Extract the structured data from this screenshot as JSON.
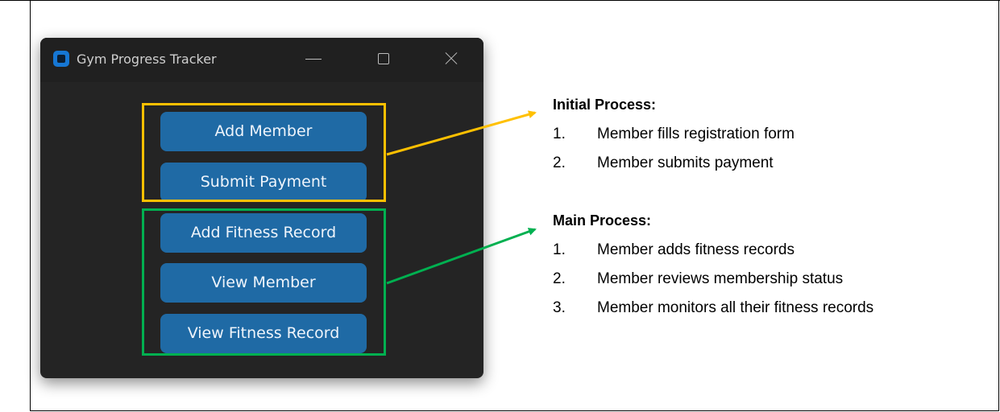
{
  "window": {
    "title": "Gym Progress Tracker"
  },
  "buttons": {
    "add_member": "Add Member",
    "submit_payment": "Submit Payment",
    "add_fitness_record": "Add Fitness Record",
    "view_member": "View Member",
    "view_fitness_record": "View Fitness Record"
  },
  "annotations": {
    "initial": {
      "heading": "Initial Process:",
      "items": [
        {
          "num": "1.",
          "text": "Member fills registration form"
        },
        {
          "num": "2.",
          "text": "Member submits payment"
        }
      ]
    },
    "main": {
      "heading": "Main Process:",
      "items": [
        {
          "num": "1.",
          "text": "Member adds fitness records"
        },
        {
          "num": "2.",
          "text": "Member reviews membership status"
        },
        {
          "num": "3.",
          "text": "Member monitors all their fitness records"
        }
      ]
    }
  },
  "colors": {
    "button": "#1f6aa5",
    "window_bg": "#242424",
    "initial_highlight": "#ffc000",
    "main_highlight": "#00b050"
  }
}
